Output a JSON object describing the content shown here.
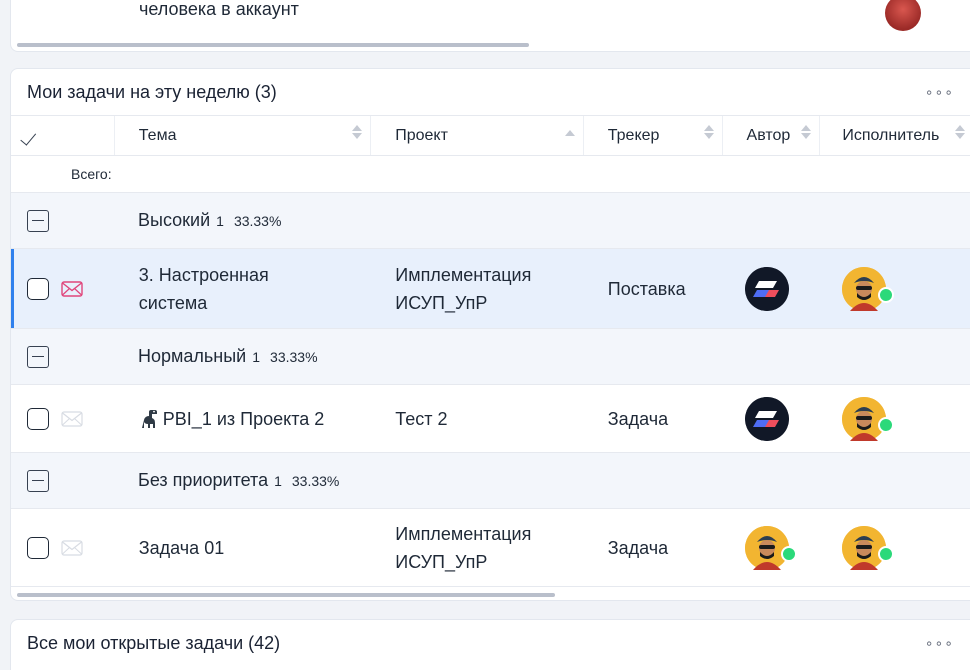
{
  "top_card": {
    "row_text": "человека в аккаунт"
  },
  "weekly": {
    "title": "Мои задачи на эту неделю (3)",
    "more": "∘∘∘",
    "columns": {
      "topic": "Тема",
      "project": "Проект",
      "tracker": "Трекер",
      "author": "Автор",
      "assignee": "Исполнитель"
    },
    "total_label": "Всего:",
    "groups": [
      {
        "label": "Высокий",
        "count": "1",
        "percent": "33.33%",
        "tasks": [
          {
            "topic_line1": "3. Настроенная",
            "topic_line2": "система",
            "project_line1": "Имплементация",
            "project_line2": "ИСУП_УпР",
            "tracker": "Поставка",
            "author": "logo-avatar",
            "assignee": "person-avatar",
            "mail": "unread",
            "selected": true
          }
        ]
      },
      {
        "label": "Нормальный",
        "count": "1",
        "percent": "33.33%",
        "tasks": [
          {
            "topic": "PBI_1 из Проекта 2",
            "topic_icon": "dinosaur-emoji",
            "project": "Тест 2",
            "tracker": "Задача",
            "author": "logo-avatar",
            "assignee": "person-avatar",
            "mail": "read"
          }
        ]
      },
      {
        "label": "Без приоритета",
        "count": "1",
        "percent": "33.33%",
        "tasks": [
          {
            "topic": "Задача 01",
            "project_line1": "Имплементация",
            "project_line2": "ИСУП_УпР",
            "tracker": "Задача",
            "author": "person-avatar",
            "assignee": "person-avatar",
            "mail": "read"
          }
        ]
      }
    ]
  },
  "open_tasks": {
    "title": "Все мои открытые задачи (42)",
    "more": "∘∘∘"
  },
  "colors": {
    "selected_row": "#e8f0fc",
    "selected_accent": "#2f80ed",
    "group_bg": "#f3f6fb",
    "online": "#2bd97a",
    "mail_unread": "#e0457b"
  }
}
